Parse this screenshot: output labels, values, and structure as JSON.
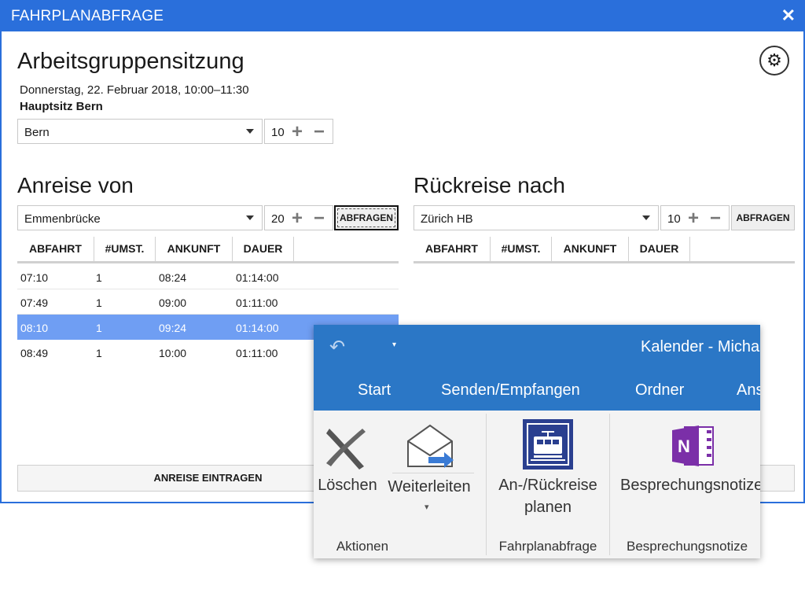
{
  "window": {
    "title": "FAHRPLANABFRAGE",
    "close_glyph": "✕"
  },
  "meeting": {
    "title": "Arbeitsgruppensitzung",
    "datetime": "Donnerstag, 22. Februar 2018, 10:00–11:30",
    "location": "Hauptsitz Bern",
    "place_select": "Bern",
    "count": "10"
  },
  "stepper": {
    "plus": "+",
    "minus": "−"
  },
  "anreise": {
    "heading": "Anreise von",
    "from_select": "Emmenbrücke",
    "count": "20",
    "query_button": "ABFRAGEN",
    "columns": [
      "ABFAHRT",
      "#UMST.",
      "ANKUNFT",
      "DAUER"
    ],
    "rows": [
      {
        "abfahrt": "07:10",
        "umst": "1",
        "ankunft": "08:24",
        "dauer": "01:14:00"
      },
      {
        "abfahrt": "07:49",
        "umst": "1",
        "ankunft": "09:00",
        "dauer": "01:11:00"
      },
      {
        "abfahrt": "08:10",
        "umst": "1",
        "ankunft": "09:24",
        "dauer": "01:14:00"
      },
      {
        "abfahrt": "08:49",
        "umst": "1",
        "ankunft": "10:00",
        "dauer": "01:11:00"
      }
    ],
    "selected_index": 2,
    "submit_button": "ANREISE EINTRAGEN"
  },
  "rueckreise": {
    "heading": "Rückreise nach",
    "to_select": "Zürich HB",
    "count": "10",
    "query_button": "ABFRAGEN",
    "columns": [
      "ABFAHRT",
      "#UMST.",
      "ANKUNFT",
      "DAUER"
    ]
  },
  "outlook": {
    "title": "Kalender - Micha",
    "tabs": [
      "Start",
      "Senden/Empfangen",
      "Ordner",
      "Ans"
    ],
    "buttons": {
      "delete": "Löschen",
      "forward": "Weiterleiten",
      "travel_line1": "An-/Rückreise",
      "travel_line2": "planen",
      "notes": "Besprechungsnotize"
    },
    "groups": {
      "actions": "Aktionen",
      "timetable": "Fahrplanabfrage",
      "notes": "Besprechungsnotize"
    },
    "colors": {
      "ribbon": "#2b77c6",
      "onenote": "#7b2fa8",
      "train_icon": "#2a3f8f"
    }
  },
  "colors": {
    "accent": "#2a6fdb",
    "selected_row": "#6f9ef3"
  }
}
